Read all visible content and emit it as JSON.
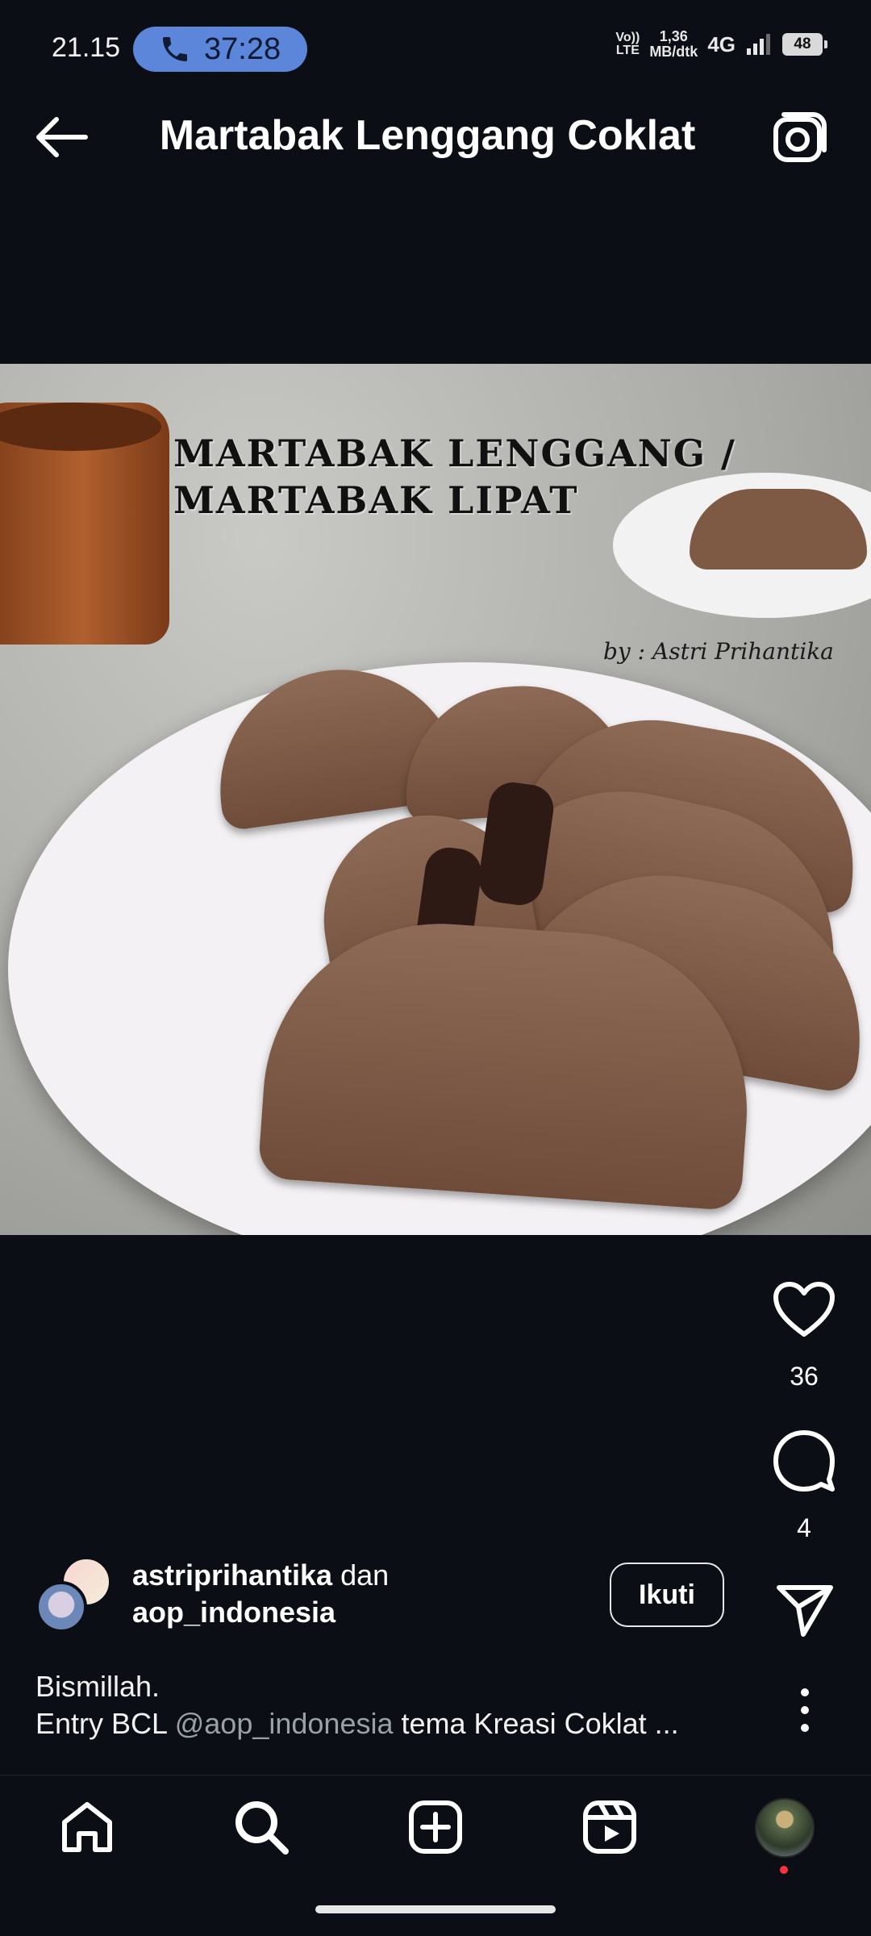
{
  "status_bar": {
    "time": "21.15",
    "call_timer": "37:28",
    "volte_label": "VoLTE",
    "net_speed_value": "1,36",
    "net_speed_unit": "MB/dtk",
    "network_type": "4G",
    "battery_level": "48"
  },
  "header": {
    "title": "Martabak Lenggang Coklat"
  },
  "post": {
    "image_caption_line1": "MARTABAK LENGGANG /",
    "image_caption_line2": "MARTABAK LIPAT",
    "image_credit": "by : Astri Prihantika",
    "like_count": "36",
    "comment_count": "4",
    "author_primary": "astriprihantika",
    "author_conjunction": "dan",
    "author_secondary": "aop_indonesia",
    "follow_label": "Ikuti",
    "caption_line1": "Bismillah.",
    "caption_line2_prefix": "Entry BCL ",
    "caption_mention": "@aop_indonesia",
    "caption_line2_suffix": " tema Kreasi Coklat ..."
  },
  "colors": {
    "background": "#0b0e14",
    "call_pill": "#5b86d9",
    "mention": "#9aa0a8",
    "notification_dot": "#ff3040"
  },
  "icons": [
    "phone-icon",
    "back-arrow-icon",
    "camera-icon",
    "heart-icon",
    "comment-icon",
    "share-icon",
    "more-vertical-icon",
    "home-icon",
    "search-icon",
    "create-icon",
    "reels-icon"
  ]
}
